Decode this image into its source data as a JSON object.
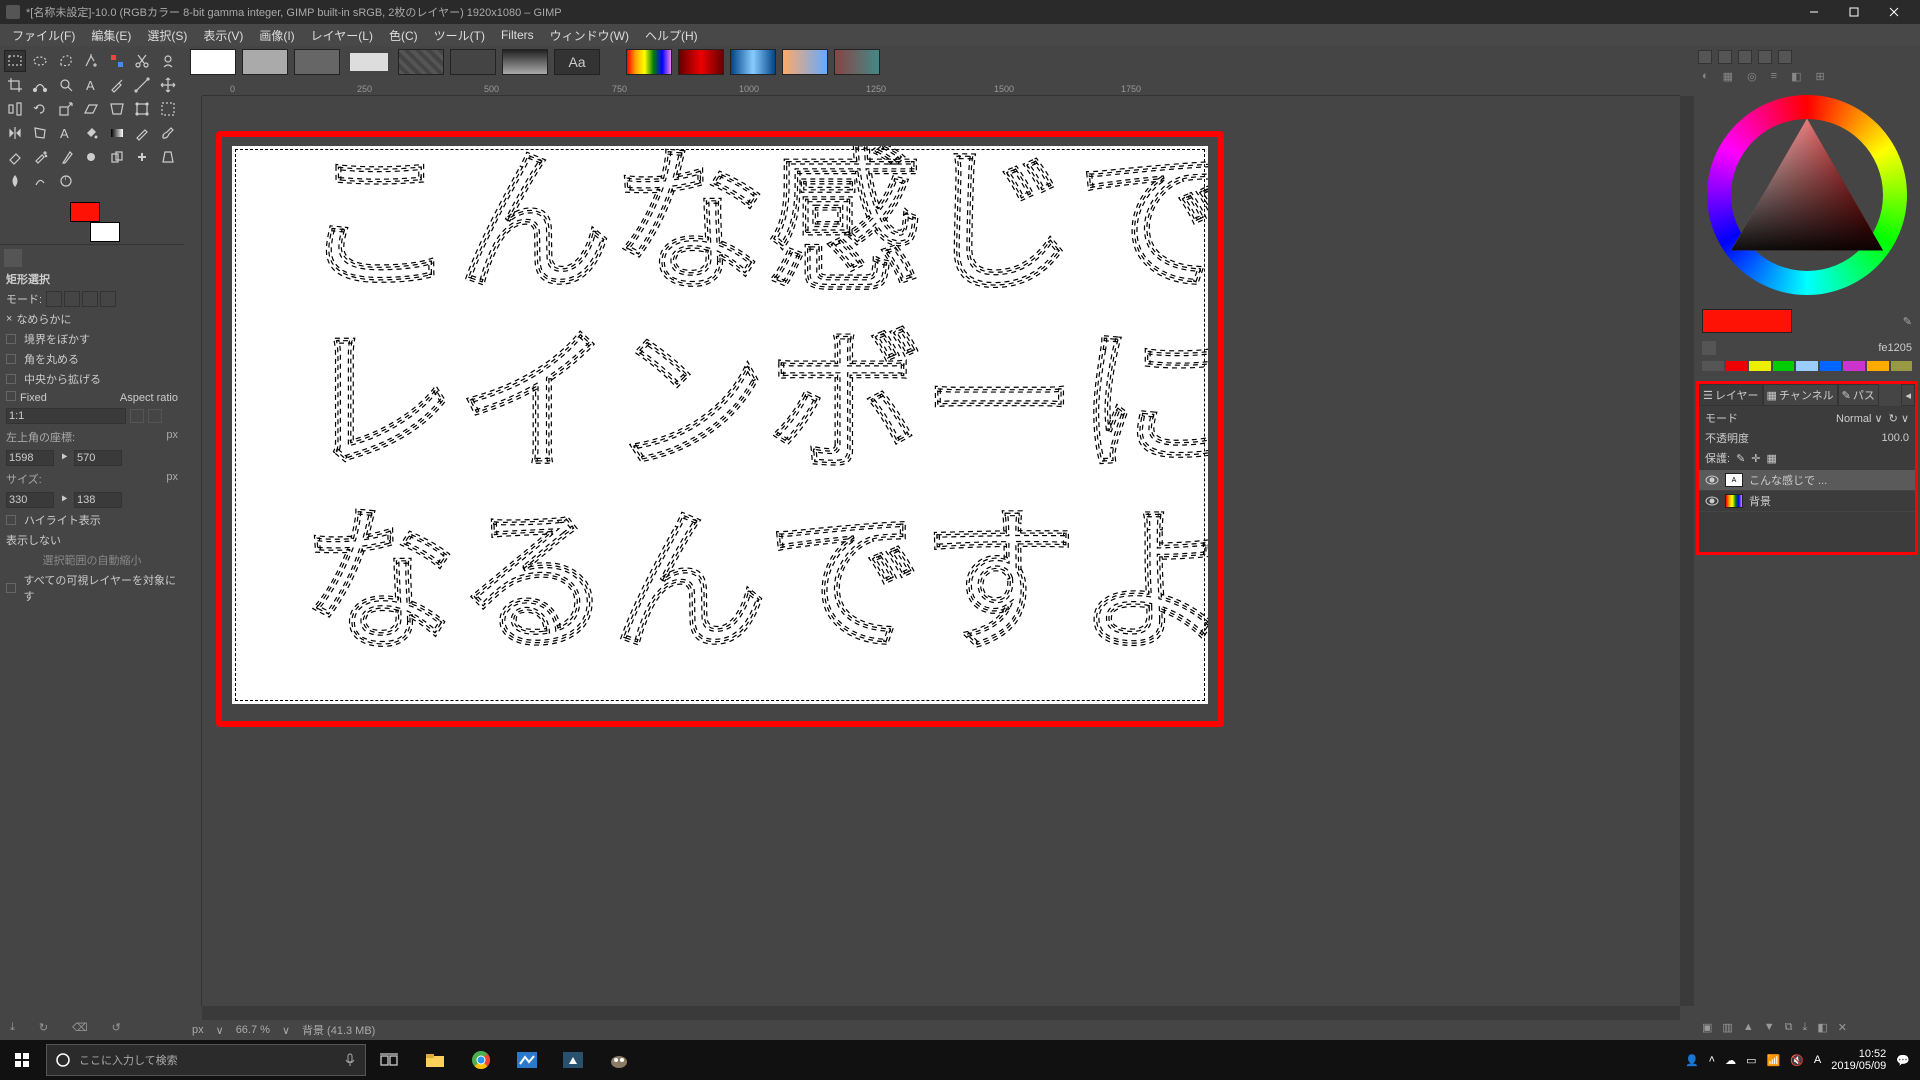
{
  "window": {
    "title": "*[名称未設定]-10.0 (RGBカラー 8-bit gamma integer, GIMP built-in sRGB, 2枚のレイヤー) 1920x1080 – GIMP"
  },
  "menu": [
    "ファイル(F)",
    "編集(E)",
    "選択(S)",
    "表示(V)",
    "画像(I)",
    "レイヤー(L)",
    "色(C)",
    "ツール(T)",
    "Filters",
    "ウィンドウ(W)",
    "ヘルプ(H)"
  ],
  "ruler_ticks": [
    "0",
    "250",
    "500",
    "750",
    "1000",
    "1250",
    "1500",
    "1750"
  ],
  "tool_options": {
    "title": "矩形選択",
    "mode_label": "モード:",
    "antialias": "なめらかに",
    "feather": "境界をぼかす",
    "round": "角を丸める",
    "expand": "中央から拡げる",
    "fixed_label": "Fixed",
    "fixed_value": "Aspect ratio",
    "ratio": "1:1",
    "origin_label": "左上角の座標:",
    "unit": "px",
    "x": "1598",
    "y": "570",
    "size_label": "サイズ:",
    "w": "330",
    "h": "138",
    "highlight": "ハイライト表示",
    "noshow": "表示しない",
    "autoshrink": "選択範囲の自動縮小",
    "alllayers": "すべての可視レイヤーを対象にす"
  },
  "canvas_text": {
    "line1": [
      "こ",
      "ん",
      "な",
      "感",
      "じ",
      "で"
    ],
    "line2": [
      "レ",
      "イ",
      "ン",
      "ボ",
      "ー",
      "に"
    ],
    "line3": [
      "な",
      "る",
      "ん",
      "で",
      "す",
      "よ"
    ]
  },
  "status": {
    "unit": "px",
    "zoom": "66.7 %",
    "layer": "背景 (41.3 MB)"
  },
  "color": {
    "hex": "fe1205",
    "fg": "#fe1205",
    "bg": "#ffffff",
    "mini": [
      "#555",
      "#e00",
      "#ee0",
      "#0c0",
      "#9cf",
      "#06f",
      "#c3c",
      "#fa0",
      "#994"
    ]
  },
  "layers_panel": {
    "tabs": [
      "レイヤー",
      "チャンネル",
      "パス"
    ],
    "mode_label": "モード",
    "mode_value": "Normal",
    "opacity_label": "不透明度",
    "opacity_value": "100.0",
    "lock_label": "保護:",
    "layers": [
      {
        "name": "こんな感じで ...",
        "visible": true,
        "thumb": "text"
      },
      {
        "name": "背景",
        "visible": true,
        "thumb": "rb"
      }
    ]
  },
  "taskbar": {
    "search_placeholder": "ここに入力して検索",
    "time": "10:52",
    "date": "2019/05/09"
  }
}
